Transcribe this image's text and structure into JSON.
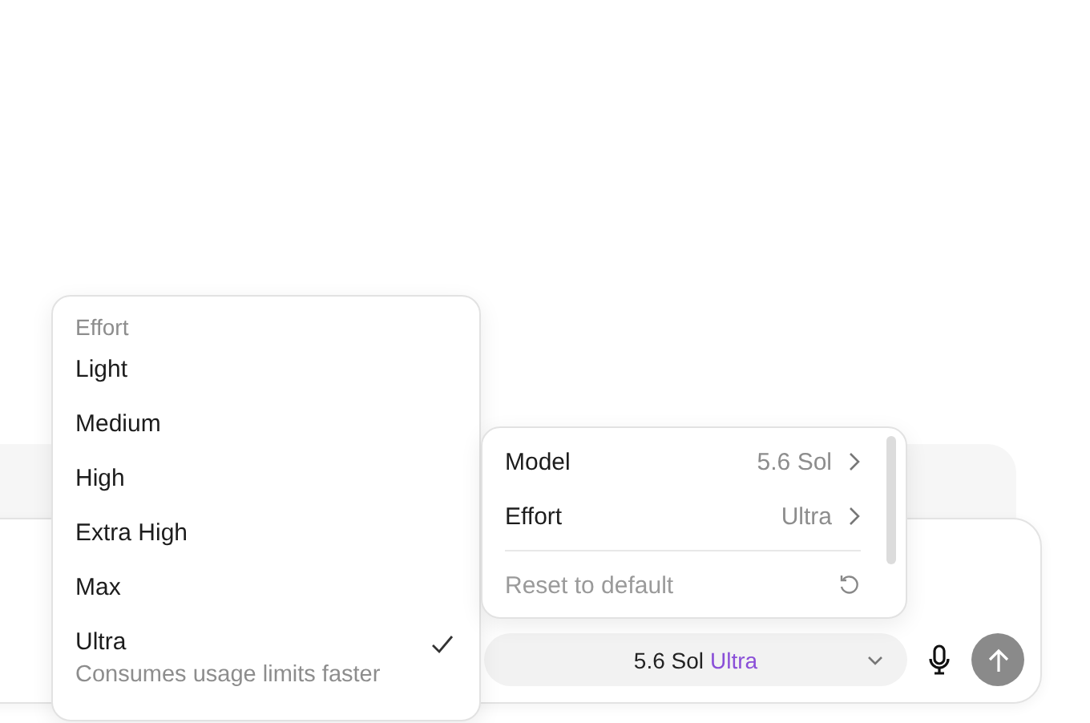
{
  "effort_menu": {
    "heading": "Effort",
    "items": [
      {
        "label": "Light",
        "selected": false
      },
      {
        "label": "Medium",
        "selected": false
      },
      {
        "label": "High",
        "selected": false
      },
      {
        "label": "Extra High",
        "selected": false
      },
      {
        "label": "Max",
        "selected": false
      },
      {
        "label": "Ultra",
        "description": "Consumes usage limits faster",
        "selected": true
      }
    ]
  },
  "settings_menu": {
    "items": [
      {
        "label": "Model",
        "value": "5.6 Sol"
      },
      {
        "label": "Effort",
        "value": "Ultra"
      }
    ],
    "reset": "Reset to default"
  },
  "model_pill": {
    "model": "5.6 Sol",
    "effort": "Ultra"
  }
}
